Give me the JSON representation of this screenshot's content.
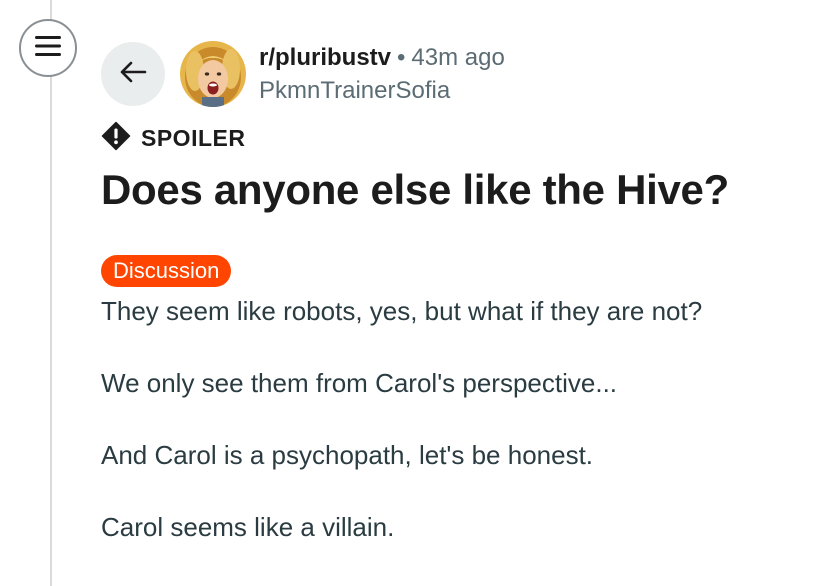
{
  "navigation": {
    "menu_icon": "hamburger-menu-icon",
    "back_icon": "arrow-left-icon"
  },
  "post": {
    "subreddit": "r/pluribustv",
    "separator": "•",
    "time_ago": "43m ago",
    "author": "PkmnTrainerSofia",
    "avatar_icon": "user-avatar",
    "spoiler_icon": "alert-icon",
    "spoiler_label": "SPOILER",
    "title": "Does anyone else like the Hive?",
    "flair": "Discussion",
    "body": [
      "They seem like robots, yes, but what if they are not?",
      "We only see them from Carol's perspective...",
      "And Carol is a psychopath, let's be honest.",
      "Carol seems like a villain."
    ]
  },
  "colors": {
    "flair_background": "#ff4500",
    "meta_text": "#5c6c74",
    "back_button_background": "#eaeded"
  }
}
